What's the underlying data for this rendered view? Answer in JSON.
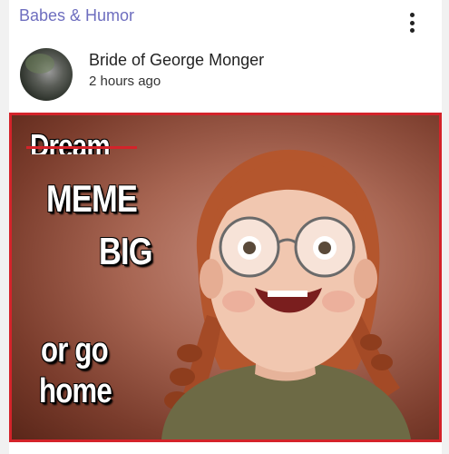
{
  "post": {
    "group_name": "Babes & Humor",
    "author": "Bride of George Monger",
    "time": "2 hours ago",
    "more_icon": "more-vertical-icon"
  },
  "meme": {
    "line1": "Dream",
    "line2": "MEME",
    "line3": "BIG",
    "line4": "or go",
    "line5": "home"
  },
  "colors": {
    "accent_link": "#6e6ebf",
    "meme_border": "#d4232a"
  }
}
